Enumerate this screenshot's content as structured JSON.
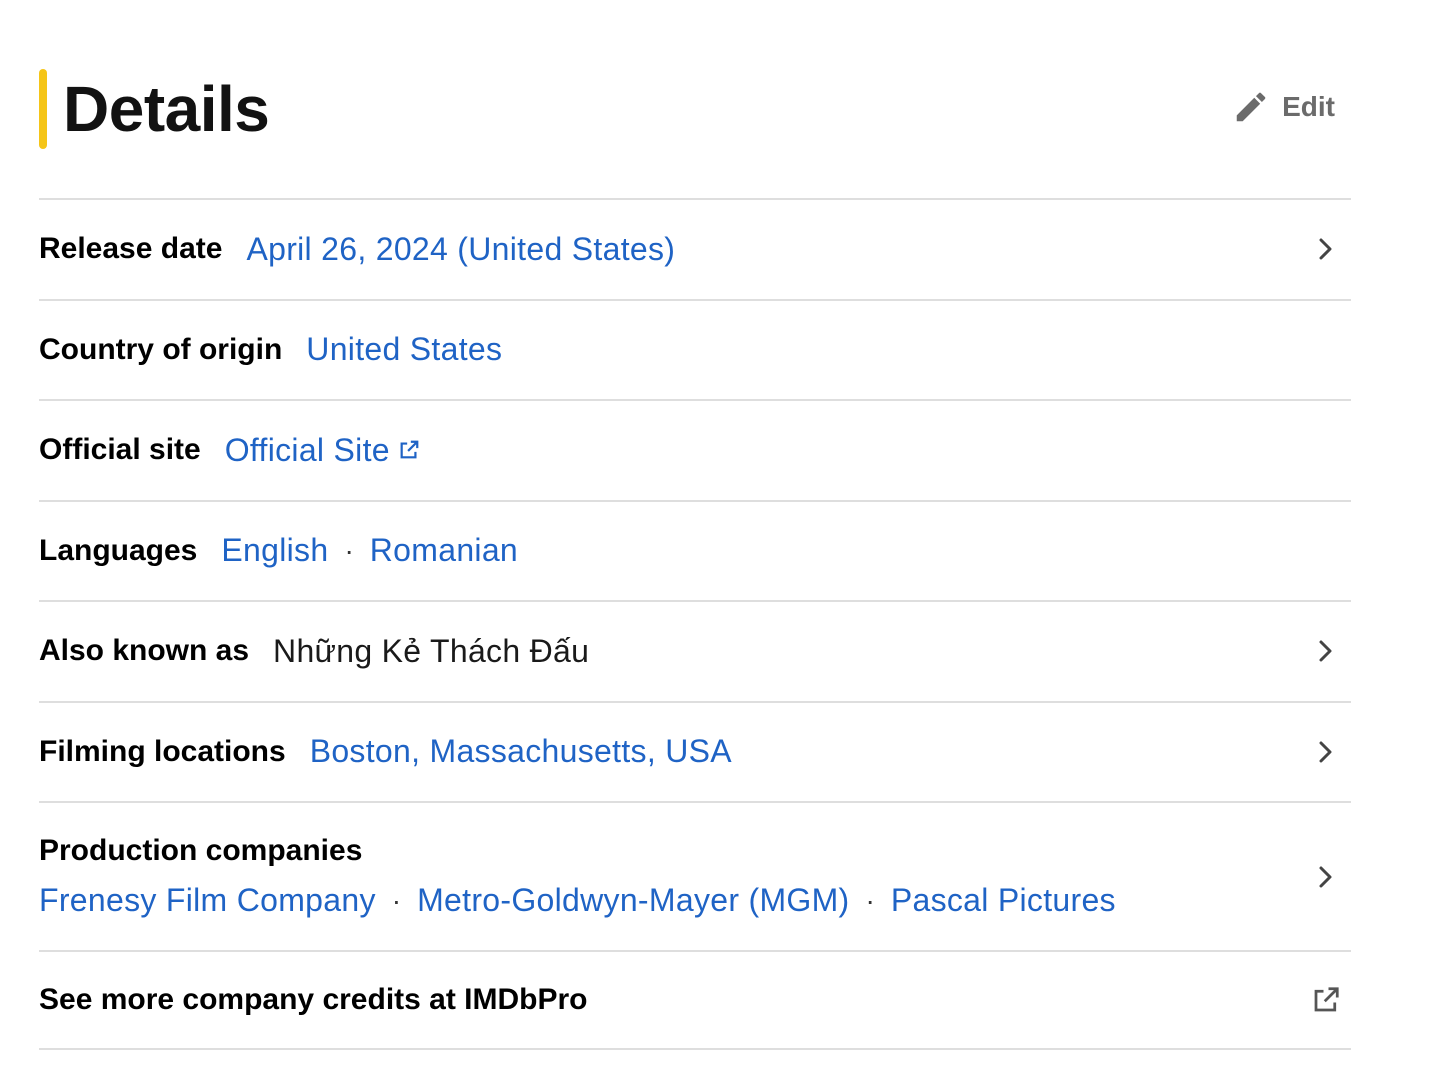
{
  "section": {
    "title": "Details",
    "edit_label": "Edit",
    "accent_color": "#f5c518",
    "link_color": "#1f63c5"
  },
  "rows": {
    "release_date": {
      "label": "Release date",
      "value": "April 26, 2024 (United States)"
    },
    "country": {
      "label": "Country of origin",
      "value": "United States"
    },
    "official_site": {
      "label": "Official site",
      "value": "Official Site"
    },
    "languages": {
      "label": "Languages",
      "values": [
        "English",
        "Romanian"
      ]
    },
    "aka": {
      "label": "Also known as",
      "value": "Những Kẻ Thách Đấu"
    },
    "filming": {
      "label": "Filming locations",
      "value": "Boston, Massachusetts, USA"
    },
    "production": {
      "label": "Production companies",
      "values": [
        "Frenesy Film Company",
        "Metro-Goldwyn-Mayer (MGM)",
        "Pascal Pictures"
      ]
    },
    "imdbpro": {
      "label": "See more company credits at IMDbPro"
    }
  },
  "icons": {
    "edit": "pencil-icon",
    "chevron": "chevron-right-icon",
    "external": "external-link-icon"
  }
}
